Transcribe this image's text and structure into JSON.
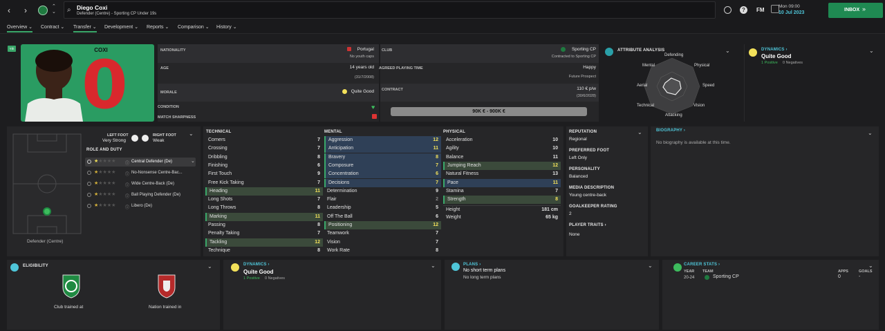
{
  "player": {
    "name": "Diego Coxi",
    "subtitle": "Defender (Centre) - Sporting CP Under 19s",
    "shirt_name": "COXI",
    "shirt_number": "0",
    "badge": "Yth"
  },
  "date": {
    "day": "Mon 09:00",
    "date": "10 Jul 2023"
  },
  "inbox": {
    "label": "INBOX"
  },
  "fm_label": "FM",
  "tabs": [
    "Overview",
    "Contract",
    "Transfer",
    "Development",
    "Reports",
    "Comparison",
    "History"
  ],
  "info": {
    "nationality_label": "NATIONALITY",
    "nationality": "Portugal",
    "youth_caps": "No youth caps",
    "age_label": "AGE",
    "age": "14 years old",
    "dob": "(31/7/2008)",
    "morale_label": "MORALE",
    "morale": "Quite Good",
    "condition_label": "CONDITION",
    "sharpness_label": "MATCH SHARPNESS",
    "club_label": "CLUB",
    "club": "Sporting CP",
    "contracted": "Contracted to Sporting CP",
    "apt_label": "AGREED PLAYING TIME",
    "apt": "Happy",
    "apt_sub": "Future Prospect",
    "contract_label": "CONTRACT",
    "wage": "110 € p/w",
    "expiry": "(30/6/2028)",
    "value": "90K € - 900K €"
  },
  "attribute_analysis": {
    "title": "ATTRIBUTE ANALYSIS",
    "labels": [
      "Defending",
      "Physical",
      "Speed",
      "Vision",
      "Attacking",
      "Technical",
      "Aerial",
      "Mental"
    ]
  },
  "dynamics": {
    "title": "DYNAMICS",
    "value": "Quite Good",
    "positives": "1 Positive",
    "negatives": "0 Negatives"
  },
  "feet": {
    "left_label": "LEFT FOOT",
    "left": "Very Strong",
    "right_label": "RIGHT FOOT",
    "right": "Weak"
  },
  "roles": {
    "title": "ROLE AND DUTY",
    "items": [
      "Central Defender (De)",
      "No-Nonsense Centre-Bac...",
      "Wide Centre-Back (De)",
      "Ball Playing Defender (De)",
      "Libero (De)"
    ]
  },
  "position_label": "Defender (Centre)",
  "technical": {
    "title": "TECHNICAL",
    "rows": [
      [
        "Corners",
        "7"
      ],
      [
        "Crossing",
        "7"
      ],
      [
        "Dribbling",
        "8"
      ],
      [
        "Finishing",
        "6"
      ],
      [
        "First Touch",
        "9"
      ],
      [
        "Free Kick Taking",
        "7"
      ],
      [
        "Heading",
        "11"
      ],
      [
        "Long Shots",
        "7"
      ],
      [
        "Long Throws",
        "8"
      ],
      [
        "Marking",
        "11"
      ],
      [
        "Passing",
        "8"
      ],
      [
        "Penalty Taking",
        "7"
      ],
      [
        "Tackling",
        "12"
      ],
      [
        "Technique",
        "8"
      ]
    ]
  },
  "mental": {
    "title": "MENTAL",
    "rows": [
      [
        "Aggression",
        "12"
      ],
      [
        "Anticipation",
        "11"
      ],
      [
        "Bravery",
        "8"
      ],
      [
        "Composure",
        "7"
      ],
      [
        "Concentration",
        "6"
      ],
      [
        "Decisions",
        "7"
      ],
      [
        "Determination",
        "9"
      ],
      [
        "Flair",
        "2"
      ],
      [
        "Leadership",
        "5"
      ],
      [
        "Off The Ball",
        "6"
      ],
      [
        "Positioning",
        "12"
      ],
      [
        "Teamwork",
        "7"
      ],
      [
        "Vision",
        "7"
      ],
      [
        "Work Rate",
        "8"
      ]
    ]
  },
  "physical": {
    "title": "PHYSICAL",
    "rows": [
      [
        "Acceleration",
        "10"
      ],
      [
        "Agility",
        "10"
      ],
      [
        "Balance",
        "11"
      ],
      [
        "Jumping Reach",
        "12"
      ],
      [
        "Natural Fitness",
        "13"
      ],
      [
        "Pace",
        "11"
      ],
      [
        "Stamina",
        "7"
      ],
      [
        "Strength",
        "8"
      ]
    ],
    "height_label": "Height",
    "height": "181 cm",
    "weight_label": "Weight",
    "weight": "65 kg"
  },
  "side": {
    "reputation_label": "REPUTATION",
    "reputation": "Regional",
    "foot_label": "PREFERRED FOOT",
    "foot": "Left Only",
    "personality_label": "PERSONALITY",
    "personality": "Balanced",
    "media_label": "MEDIA DESCRIPTION",
    "media": "Young centre-back",
    "gk_label": "GOALKEEPER RATING",
    "gk": "2",
    "traits_label": "PLAYER TRAITS",
    "traits": "None"
  },
  "biography": {
    "title": "BIOGRAPHY",
    "text": "No biography is available at this time."
  },
  "eligibility": {
    "title": "ELIGIBILITY",
    "club": "Club trained at",
    "nation": "Nation trained in"
  },
  "plans": {
    "title": "PLANS",
    "short": "No short term plans",
    "long": "No long term plans"
  },
  "career": {
    "title": "CAREER STATS",
    "year_h": "YEAR",
    "team_h": "TEAM",
    "apps_h": "APPS",
    "goals_h": "GOALS",
    "year": "20-24",
    "team": "Sporting CP",
    "apps": "0",
    "goals": "-"
  },
  "colors": {
    "accent": "#3aa86a",
    "highlight_blue": "#2f4057",
    "highlight_green": "#3b4a3b",
    "yellow": "#f3e15a",
    "cyan": "#4fc6d9"
  }
}
